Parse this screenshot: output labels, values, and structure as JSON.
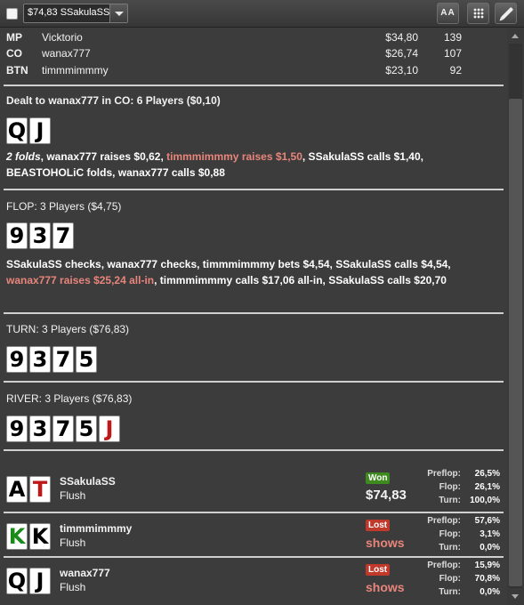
{
  "toolbar": {
    "hand_selector": "$74,83 SSakulaSS",
    "font_button": "AA"
  },
  "players": [
    {
      "pos": "MP",
      "name": "Vicktorio",
      "stack": "$34,80",
      "bb": "139"
    },
    {
      "pos": "CO",
      "name": "wanax777",
      "stack": "$26,74",
      "bb": "107"
    },
    {
      "pos": "BTN",
      "name": "timmmimmmy",
      "stack": "$23,10",
      "bb": "92"
    }
  ],
  "preflop": {
    "title": "Dealt to wanax777 in CO: 6 Players ($0,10)",
    "cards": [
      "Q",
      "J"
    ],
    "actions": {
      "folds": "2 folds",
      "a1": ", wanax777 raises $0,62, ",
      "a2_highlight": "timmmimmmy raises $1,50",
      "a3": ", SSakulaSS calls $1,40, BEASTOHOLiC folds, wanax777 calls $0,88"
    }
  },
  "flop": {
    "title": "FLOP: 3 Players ($4,75)",
    "cards": [
      "9",
      "3",
      "7"
    ],
    "actions": {
      "a1": "SSakulaSS checks, wanax777 checks, timmmimmmy bets $4,54, SSakulaSS calls $4,54, ",
      "a2_highlight": "wanax777 raises $25,24 all-in",
      "a3": ", timmmimmmy calls $17,06 all-in, SSakulaSS calls $20,70"
    }
  },
  "turn": {
    "title": "TURN: 3 Players ($76,83)",
    "cards": [
      "9",
      "3",
      "7",
      "5"
    ]
  },
  "river": {
    "title": "RIVER: 3 Players ($76,83)",
    "cards": [
      "9",
      "3",
      "7",
      "5",
      "J"
    ]
  },
  "showdown": [
    {
      "name": "SSakulaSS",
      "hand": "Flush",
      "cards": [
        "A",
        "T"
      ],
      "card_colors": [
        "black",
        "red"
      ],
      "result": "Won",
      "amount": "$74,83",
      "equity": {
        "preflop_label": "Preflop:",
        "preflop": "26,5%",
        "flop_label": "Flop:",
        "flop": "26,1%",
        "turn_label": "Turn:",
        "turn": "100,0%"
      }
    },
    {
      "name": "timmmimmmy",
      "hand": "Flush",
      "cards": [
        "K",
        "K"
      ],
      "card_colors": [
        "green",
        "black"
      ],
      "result": "Lost",
      "amount": "shows",
      "equity": {
        "preflop_label": "Preflop:",
        "preflop": "57,6%",
        "flop_label": "Flop:",
        "flop": "3,1%",
        "turn_label": "Turn:",
        "turn": "0,0%"
      }
    },
    {
      "name": "wanax777",
      "hand": "Flush",
      "cards": [
        "Q",
        "J"
      ],
      "card_colors": [
        "black",
        "black"
      ],
      "result": "Lost",
      "amount": "shows",
      "equity": {
        "preflop_label": "Preflop:",
        "preflop": "15,9%",
        "flop_label": "Flop:",
        "flop": "70,8%",
        "turn_label": "Turn:",
        "turn": "0,0%"
      }
    }
  ],
  "colors": {
    "background": "#3c3c3c",
    "highlight_action": "#e8857b",
    "won_badge": "#3d8a1e",
    "lost_badge": "#c0392b",
    "red_card": "#c01818",
    "green_card": "#1a8a1a"
  }
}
